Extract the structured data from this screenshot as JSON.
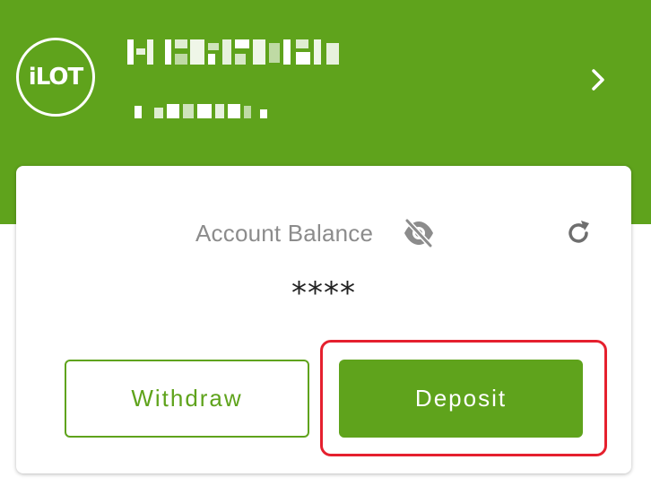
{
  "header": {
    "logo_text": "iLOT",
    "background_color": "#5fa31c",
    "account_id_redacted": true,
    "account_sub_redacted": true,
    "chevron_icon": "chevron-right-icon"
  },
  "card": {
    "balance_label": "Account Balance",
    "visibility_icon": "eye-off-icon",
    "refresh_icon": "refresh-icon",
    "balance_value": "****",
    "withdraw_label": "Withdraw",
    "deposit_label": "Deposit"
  },
  "colors": {
    "accent": "#5fa31c",
    "highlight": "#e5202e",
    "label_gray": "#8c8c8c"
  }
}
